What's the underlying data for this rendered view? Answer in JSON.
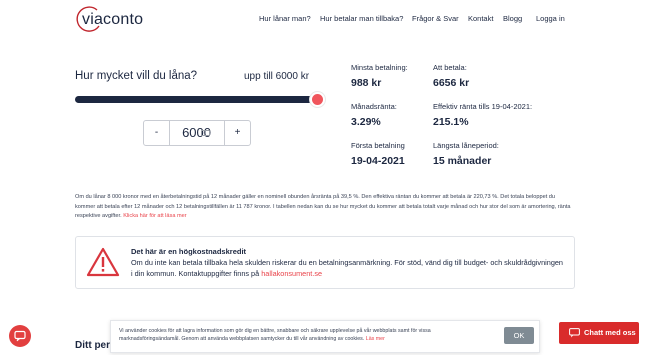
{
  "brand": {
    "logo_text": "viaconto",
    "accent": "#e9434a",
    "navy": "#1c2740"
  },
  "nav": {
    "items": [
      "Hur lånar man?",
      "Hur betalar man tillbaka?",
      "Frågor & Svar",
      "Kontakt",
      "Blogg"
    ],
    "login": "Logga in"
  },
  "calculator": {
    "title": "Hur mycket vill du låna?",
    "max_label": "upp till 6000 kr",
    "slider_fraction": 1.0,
    "minus_label": "-",
    "plus_label": "+",
    "amount_value": "6000"
  },
  "stats": {
    "min_payment": {
      "label": "Minsta betalning:",
      "value": "988 kr"
    },
    "to_pay": {
      "label": "Att betala:",
      "value": "6656 kr"
    },
    "monthly_rate": {
      "label": "Månadsränta:",
      "value": "3.29%"
    },
    "effective_rate": {
      "label": "Effektiv ränta tills 19-04-2021:",
      "value": "215.1%"
    },
    "first_payment": {
      "label": "Första betalning",
      "value": "19-04-2021"
    },
    "longest_period": {
      "label": "Längsta låneperiod:",
      "value": "15 månader"
    }
  },
  "description": {
    "text": "Om du lånar 8 000 kronor med en återbetalningstid på 12 månader gäller en nominell obunden årsränta på 39,5 %. Den effektiva räntan du kommer att betala är 220,73 %. Det totala beloppet du kommer att betala efter 12 månader och 12 betalningstillfällen är 11 787 kronor. I tabellen nedan kan du se hur mycket du kommer att betala totalt varje månad och hur stor del som är amortering, ränta respektive avgifter.",
    "link": "Klicka här för att läsa mer"
  },
  "warning": {
    "icon": "warning-triangle-icon",
    "title": "Det här är en högkostnadskredit",
    "text": "Om du inte kan betala tillbaka hela skulden riskerar du en betalningsanmärkning. För stöd, vänd dig till budget- och skuldrådgivningen i din kommun. Kontaktuppgifter finns på",
    "link": "hallakonsument.se"
  },
  "bottom": {
    "heading": "Ditt perso"
  },
  "cookie": {
    "text": "Vi använder cookies för att lagra information som gör dig en bättre, snabbare och säkrare upplevelse på vår webbplats samt för vissa marknadsföringsändamål. Genom att använda webbplatsen samtycker du till vår användning av cookies.",
    "link": "Läs mer",
    "ok_label": "OK"
  },
  "chat": {
    "label": "Chatt med oss",
    "icon": "chat-icon"
  }
}
